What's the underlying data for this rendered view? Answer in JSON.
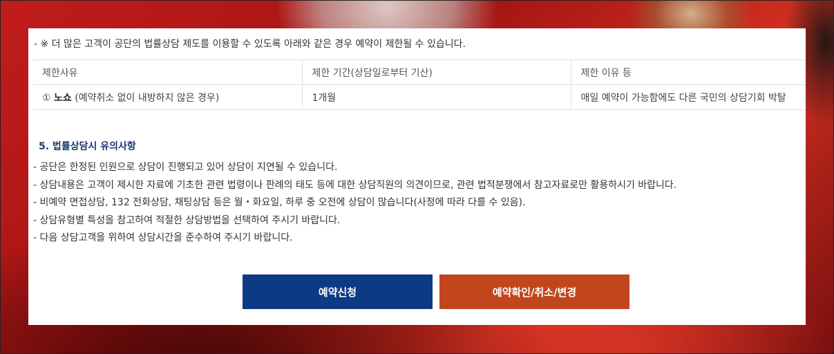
{
  "notice": "- ※ 더 많은 고객이 공단의 법률상담 제도를 이용할 수 있도록 아래와 같은 경우 예약이 제한될 수 있습니다.",
  "restriction_table": {
    "headers": [
      "제한사유",
      "제한 기간(상담일로부터 기산)",
      "제한 이유 등"
    ],
    "rows": [
      {
        "reason_prefix": "① ",
        "reason_bold": "노쇼",
        "reason_rest": " (예약취소 없이 내방하지 않은 경우)",
        "period": "1개월",
        "why": "매일 예약이 가능함에도 다른 국민의 상담기회 박탈"
      }
    ]
  },
  "section": {
    "title": "5. 법률상담시 유의사항",
    "notes": [
      "- 공단은 한정된 인원으로 상담이 진행되고 있어 상담이 지연될 수 있습니다.",
      "- 상담내용은 고객이 제시한 자료에 기초한 관련 법령이나 판례의 태도 등에 대한 상담직원의 의견이므로, 관련 법적분쟁에서 참고자료로만 활용하시기 바랍니다.",
      "- 비예약 면접상담, 132 전화상담, 채팅상담 등은 월・화요일, 하루 중 오전에 상담이 많습니다(사정에 따라 다를 수 있음).",
      "- 상담유형별 특성을 참고하여 적절한 상담방법을 선택하여 주시기 바랍니다.",
      "- 다음 상담고객을 위하여 상담시간을 준수하여 주시기 바랍니다."
    ]
  },
  "buttons": {
    "apply": "예약신청",
    "check": "예약확인/취소/변경"
  },
  "colors": {
    "apply_button": "#0d3a84",
    "check_button": "#c2461d",
    "section_title": "#1a3a6b"
  }
}
